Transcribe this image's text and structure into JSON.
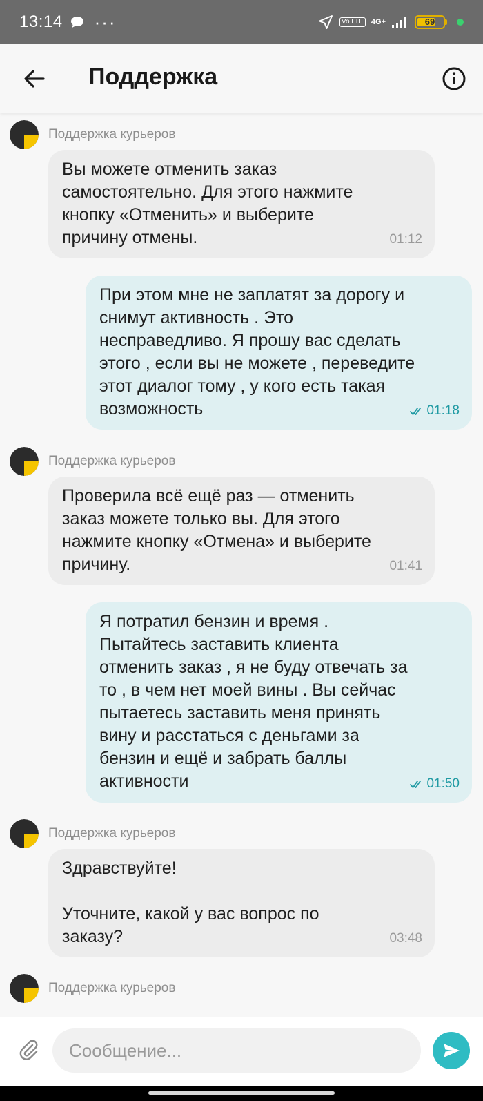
{
  "status_bar": {
    "time": "13:14",
    "icons": [
      "chat-bubble-icon",
      "more-dots-icon",
      "navigation-arrow-icon",
      "volte-icon",
      "signal-icon",
      "battery-icon"
    ],
    "volte": "Vo LTE",
    "network": "4G+",
    "battery_level": "69",
    "dots": "···"
  },
  "app_bar": {
    "title": "Поддержка",
    "back_icon": "arrow-left-icon",
    "info_icon": "info-icon"
  },
  "messages": [
    {
      "direction": "in",
      "sender": "Поддержка курьеров",
      "text": "Вы можете отменить заказ\nсамостоятельно. Для этого нажмите\nкнопку «Отменить» и выберите\nпричину отмены.",
      "time": "01:12"
    },
    {
      "direction": "out",
      "text": "При этом мне не заплатят за дорогу и\nснимут активность . Это\nнесправедливо. Я прошу вас сделать\nэтого , если вы не можете , переведите\nэтот диалог тому , у кого есть такая\nвозможность",
      "time": "01:18"
    },
    {
      "direction": "in",
      "sender": "Поддержка курьеров",
      "text": "Проверила всё ещё раз — отменить\nзаказ можете только вы. Для этого\nнажмите кнопку «Отмена» и выберите\nпричину.",
      "time": "01:41"
    },
    {
      "direction": "out",
      "text": "Я потратил бензин и время .\nПытайтесь заставить клиента\nотменить заказ , я не буду отвечать за\nто , в чем нет моей вины . Вы сейчас\nпытаетесь заставить меня принять\nвину и расстаться с деньгами за\nбензин и ещё и забрать баллы\nактивности",
      "time": "01:50"
    },
    {
      "direction": "in",
      "sender": "Поддержка курьеров",
      "text": "Здравствуйте!\n\nУточните, какой у вас вопрос по\nзаказу?",
      "time": "03:48"
    },
    {
      "direction": "in",
      "sender": "Поддержка курьеров"
    }
  ],
  "composer": {
    "placeholder": "Сообщение...",
    "attach_icon": "paperclip-icon",
    "send_icon": "send-icon"
  },
  "colors": {
    "incoming_bubble": "#ececec",
    "outgoing_bubble": "#dff0f2",
    "accent": "#2fbcc3",
    "avatar_yellow": "#f5c400",
    "avatar_dark": "#2b2b2b"
  }
}
